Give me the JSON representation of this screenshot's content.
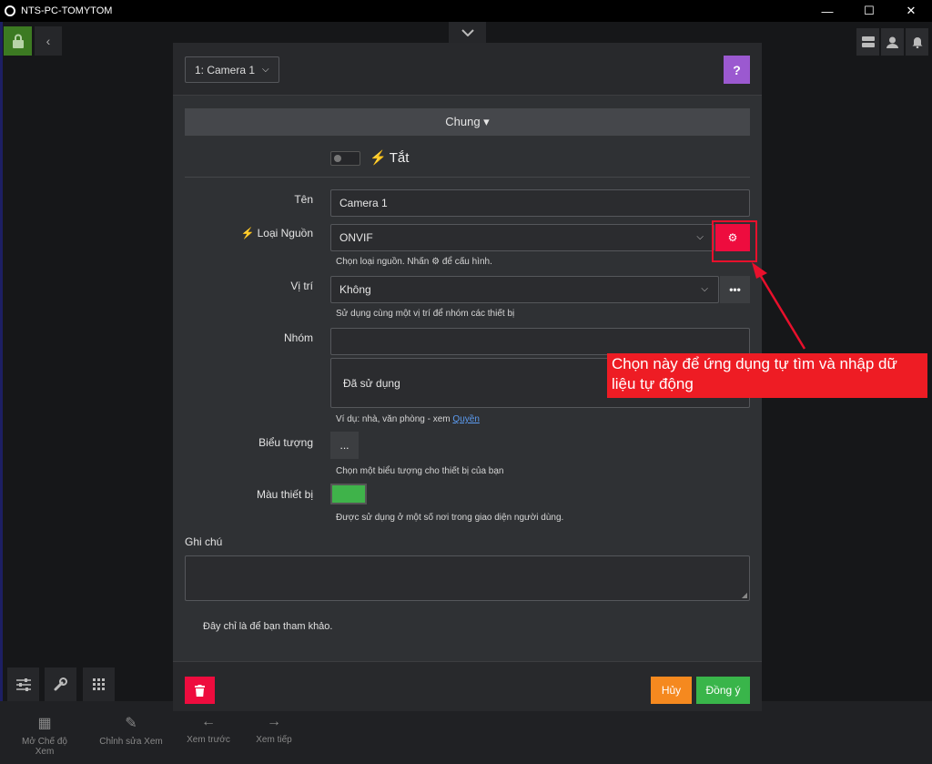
{
  "window": {
    "title": "NTS-PC-TOMYTOM",
    "minimize": "—",
    "maximize": "☐",
    "close": "✕"
  },
  "header": {
    "camera_select": "1: Camera 1",
    "help_label": "?"
  },
  "section": {
    "title": "Chung ▾"
  },
  "toggle": {
    "label": "Tắt",
    "enabled": false
  },
  "form": {
    "name": {
      "label": "Tên",
      "value": "Camera 1"
    },
    "source": {
      "label": "Loại Nguồn",
      "value": "ONVIF",
      "hint_before": "Chọn loại nguồn. Nhấn",
      "hint_after": "để cấu hình."
    },
    "location": {
      "label": "Vị trí",
      "value": "Không",
      "hint": "Sử dụng cùng một vị trí để nhóm các thiết bị"
    },
    "group": {
      "label": "Nhóm",
      "value": "",
      "used_label": "Đã sử dụng",
      "hint_before": "Ví dụ: nhà, văn phòng - xem",
      "hint_link": "Quyền"
    },
    "icon": {
      "label": "Biểu tượng",
      "button": "...",
      "hint": "Chọn một biểu tượng cho thiết bị của bạn"
    },
    "color": {
      "label": "Màu thiết bị",
      "value": "#3fb34a",
      "hint": "Được sử dụng ở một số nơi trong giao diện người dùng."
    },
    "notes": {
      "label": "Ghi chú",
      "value": ""
    },
    "reference": "Đây chỉ là để bạn tham khảo."
  },
  "footer": {
    "cancel": "Hủy",
    "ok": "Đồng ý"
  },
  "annotation": {
    "callout_text": "Chọn này để ứng dụng tự tìm và nhập dữ liệu tự động"
  },
  "bottombar": {
    "items": [
      {
        "label": "Mở Chế độ Xem",
        "icon": "grid-icon"
      },
      {
        "label": "Chỉnh sửa Xem",
        "icon": "edit-icon"
      },
      {
        "label": "Xem trước",
        "icon": "arrow-left-icon"
      },
      {
        "label": "Xem tiếp",
        "icon": "arrow-right-icon"
      }
    ]
  },
  "colors": {
    "accent_red": "#ee0c3e",
    "cancel_orange": "#f5891f",
    "ok_green": "#39b54a",
    "help_purple": "#9b59d0",
    "lock_green": "#3c7a22"
  }
}
